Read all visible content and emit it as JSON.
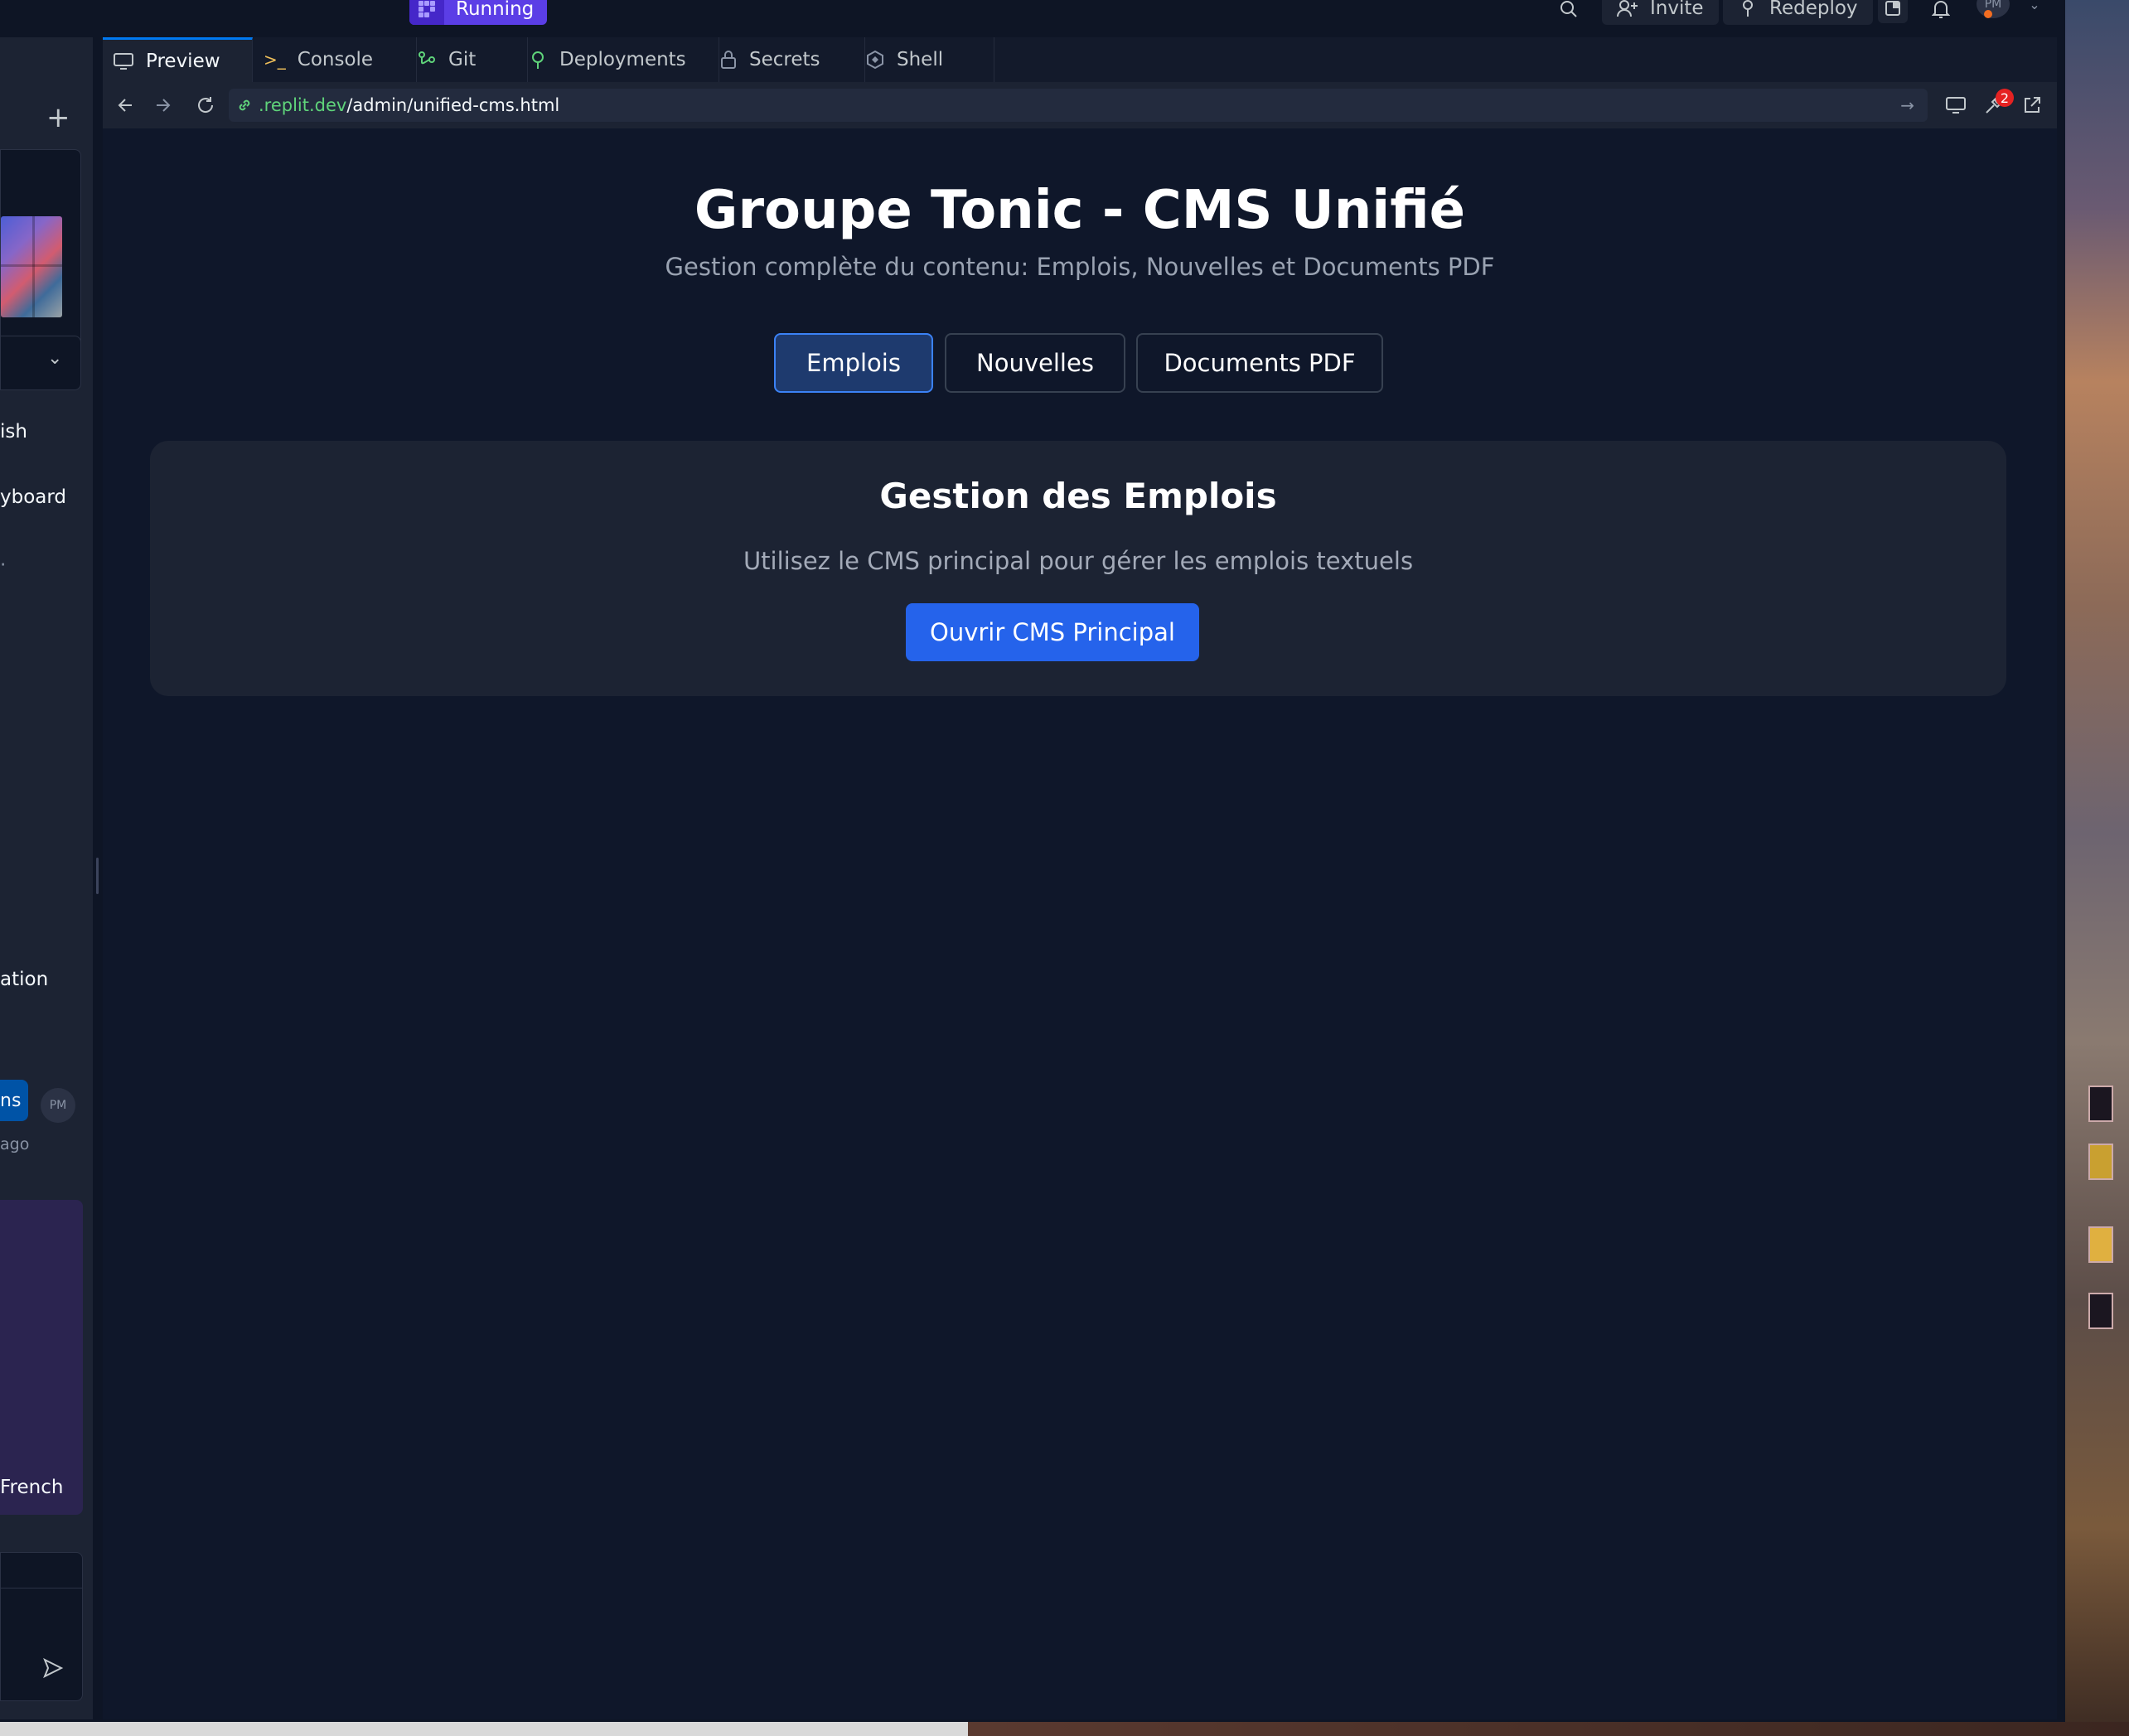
{
  "topbar": {
    "run_status": "Running",
    "invite_label": "Invite",
    "redeploy_label": "Redeploy",
    "avatar_initials": "PM"
  },
  "left_panel": {
    "item_1": "ish",
    "item_2": "yboard",
    "item_3": "ation",
    "message_button": "ns",
    "message_avatar": "PM",
    "message_time": "ago",
    "item_4": "French"
  },
  "tabs": [
    {
      "label": "Preview",
      "icon": "monitor-icon"
    },
    {
      "label": "Console",
      "icon": "terminal-icon"
    },
    {
      "label": "Git",
      "icon": "git-icon"
    },
    {
      "label": "Deployments",
      "icon": "deploy-icon"
    },
    {
      "label": "Secrets",
      "icon": "lock-icon"
    },
    {
      "label": "Shell",
      "icon": "shell-icon"
    }
  ],
  "address": {
    "host": ".replit.dev",
    "path": "/admin/unified-cms.html",
    "devtools_badge": "2"
  },
  "page": {
    "title": "Groupe Tonic - CMS Unifié",
    "subtitle": "Gestion complète du contenu: Emplois, Nouvelles et Documents PDF",
    "cms_tabs": [
      "Emplois",
      "Nouvelles",
      "Documents PDF"
    ],
    "active_tab": "Emplois",
    "card": {
      "title": "Gestion des Emplois",
      "text": "Utilisez le CMS principal pour gérer les emplois textuels",
      "button": "Ouvrir CMS Principal"
    }
  },
  "colors": {
    "accent": "#2563eb",
    "run_badge": "#5b3ee6",
    "page_bg": "#0f172a",
    "card_bg": "#1c2333",
    "url_host": "#5fd37a"
  }
}
